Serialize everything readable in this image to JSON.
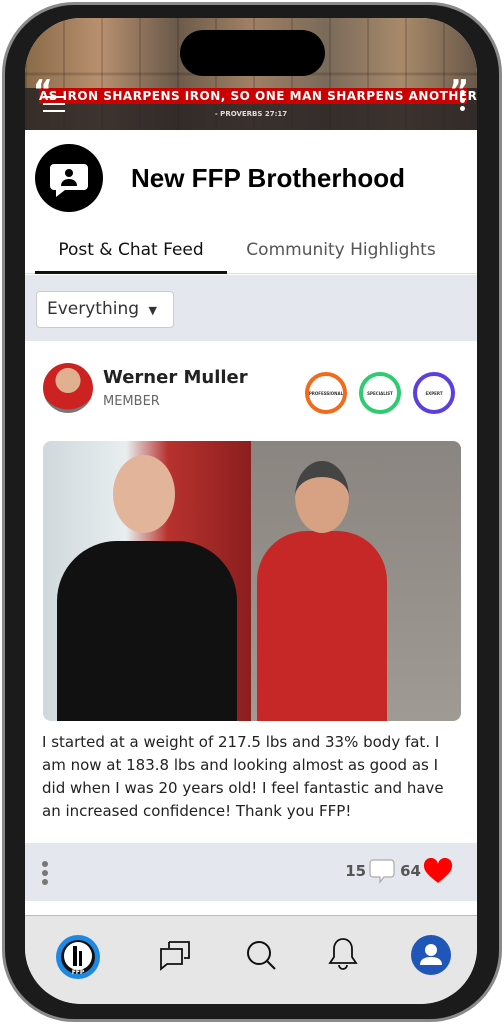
{
  "banner": {
    "quote": "AS IRON SHARPENS IRON, SO ONE MAN SHARPENS ANOTHER",
    "verse": "- PROVERBS 27:17"
  },
  "group": {
    "title": "New FFP Brotherhood"
  },
  "tabs": [
    {
      "label": "Post & Chat Feed",
      "active": true
    },
    {
      "label": "Community Highlights",
      "active": false
    }
  ],
  "filter": {
    "selected": "Everything"
  },
  "post": {
    "author": "Werner Muller",
    "role": "MEMBER",
    "badges": [
      {
        "label": "PROFESSIONAL",
        "color": "#f26a1b"
      },
      {
        "label": "SPECIALIST",
        "color": "#2ecc71"
      },
      {
        "label": "EXPERT",
        "color": "#5b3fe0"
      }
    ],
    "text": "I started at a weight of 217.5 lbs and 33% body fat. I am now at 183.8 lbs and looking almost as good as I did when I was 20 years old! I feel fantastic and have an increased confidence! Thank you FFP!",
    "comments": "15",
    "likes": "64"
  },
  "nav": {
    "logo_text": "FFP",
    "items": [
      "home-logo",
      "chat-icon",
      "search-icon",
      "bell-icon",
      "profile-icon"
    ],
    "accent": "#1f56b8"
  }
}
